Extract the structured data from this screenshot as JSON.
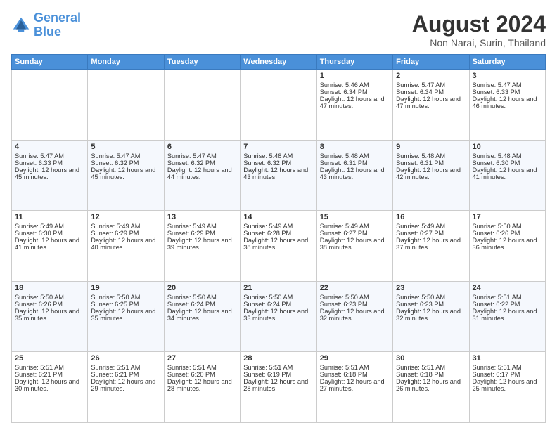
{
  "logo": {
    "line1": "General",
    "line2": "Blue"
  },
  "title": "August 2024",
  "location": "Non Narai, Surin, Thailand",
  "weekdays": [
    "Sunday",
    "Monday",
    "Tuesday",
    "Wednesday",
    "Thursday",
    "Friday",
    "Saturday"
  ],
  "weeks": [
    [
      {
        "day": "",
        "text": ""
      },
      {
        "day": "",
        "text": ""
      },
      {
        "day": "",
        "text": ""
      },
      {
        "day": "",
        "text": ""
      },
      {
        "day": "1",
        "text": "Sunrise: 5:46 AM\nSunset: 6:34 PM\nDaylight: 12 hours and 47 minutes."
      },
      {
        "day": "2",
        "text": "Sunrise: 5:47 AM\nSunset: 6:34 PM\nDaylight: 12 hours and 47 minutes."
      },
      {
        "day": "3",
        "text": "Sunrise: 5:47 AM\nSunset: 6:33 PM\nDaylight: 12 hours and 46 minutes."
      }
    ],
    [
      {
        "day": "4",
        "text": "Sunrise: 5:47 AM\nSunset: 6:33 PM\nDaylight: 12 hours and 45 minutes."
      },
      {
        "day": "5",
        "text": "Sunrise: 5:47 AM\nSunset: 6:32 PM\nDaylight: 12 hours and 45 minutes."
      },
      {
        "day": "6",
        "text": "Sunrise: 5:47 AM\nSunset: 6:32 PM\nDaylight: 12 hours and 44 minutes."
      },
      {
        "day": "7",
        "text": "Sunrise: 5:48 AM\nSunset: 6:32 PM\nDaylight: 12 hours and 43 minutes."
      },
      {
        "day": "8",
        "text": "Sunrise: 5:48 AM\nSunset: 6:31 PM\nDaylight: 12 hours and 43 minutes."
      },
      {
        "day": "9",
        "text": "Sunrise: 5:48 AM\nSunset: 6:31 PM\nDaylight: 12 hours and 42 minutes."
      },
      {
        "day": "10",
        "text": "Sunrise: 5:48 AM\nSunset: 6:30 PM\nDaylight: 12 hours and 41 minutes."
      }
    ],
    [
      {
        "day": "11",
        "text": "Sunrise: 5:49 AM\nSunset: 6:30 PM\nDaylight: 12 hours and 41 minutes."
      },
      {
        "day": "12",
        "text": "Sunrise: 5:49 AM\nSunset: 6:29 PM\nDaylight: 12 hours and 40 minutes."
      },
      {
        "day": "13",
        "text": "Sunrise: 5:49 AM\nSunset: 6:29 PM\nDaylight: 12 hours and 39 minutes."
      },
      {
        "day": "14",
        "text": "Sunrise: 5:49 AM\nSunset: 6:28 PM\nDaylight: 12 hours and 38 minutes."
      },
      {
        "day": "15",
        "text": "Sunrise: 5:49 AM\nSunset: 6:27 PM\nDaylight: 12 hours and 38 minutes."
      },
      {
        "day": "16",
        "text": "Sunrise: 5:49 AM\nSunset: 6:27 PM\nDaylight: 12 hours and 37 minutes."
      },
      {
        "day": "17",
        "text": "Sunrise: 5:50 AM\nSunset: 6:26 PM\nDaylight: 12 hours and 36 minutes."
      }
    ],
    [
      {
        "day": "18",
        "text": "Sunrise: 5:50 AM\nSunset: 6:26 PM\nDaylight: 12 hours and 35 minutes."
      },
      {
        "day": "19",
        "text": "Sunrise: 5:50 AM\nSunset: 6:25 PM\nDaylight: 12 hours and 35 minutes."
      },
      {
        "day": "20",
        "text": "Sunrise: 5:50 AM\nSunset: 6:24 PM\nDaylight: 12 hours and 34 minutes."
      },
      {
        "day": "21",
        "text": "Sunrise: 5:50 AM\nSunset: 6:24 PM\nDaylight: 12 hours and 33 minutes."
      },
      {
        "day": "22",
        "text": "Sunrise: 5:50 AM\nSunset: 6:23 PM\nDaylight: 12 hours and 32 minutes."
      },
      {
        "day": "23",
        "text": "Sunrise: 5:50 AM\nSunset: 6:23 PM\nDaylight: 12 hours and 32 minutes."
      },
      {
        "day": "24",
        "text": "Sunrise: 5:51 AM\nSunset: 6:22 PM\nDaylight: 12 hours and 31 minutes."
      }
    ],
    [
      {
        "day": "25",
        "text": "Sunrise: 5:51 AM\nSunset: 6:21 PM\nDaylight: 12 hours and 30 minutes."
      },
      {
        "day": "26",
        "text": "Sunrise: 5:51 AM\nSunset: 6:21 PM\nDaylight: 12 hours and 29 minutes."
      },
      {
        "day": "27",
        "text": "Sunrise: 5:51 AM\nSunset: 6:20 PM\nDaylight: 12 hours and 28 minutes."
      },
      {
        "day": "28",
        "text": "Sunrise: 5:51 AM\nSunset: 6:19 PM\nDaylight: 12 hours and 28 minutes."
      },
      {
        "day": "29",
        "text": "Sunrise: 5:51 AM\nSunset: 6:18 PM\nDaylight: 12 hours and 27 minutes."
      },
      {
        "day": "30",
        "text": "Sunrise: 5:51 AM\nSunset: 6:18 PM\nDaylight: 12 hours and 26 minutes."
      },
      {
        "day": "31",
        "text": "Sunrise: 5:51 AM\nSunset: 6:17 PM\nDaylight: 12 hours and 25 minutes."
      }
    ]
  ]
}
